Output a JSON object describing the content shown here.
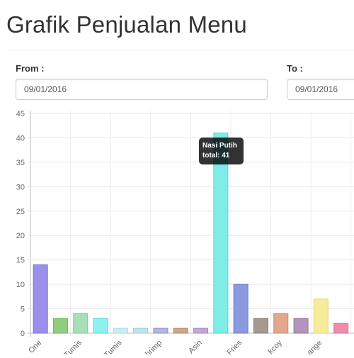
{
  "page": {
    "title": "Grafik Penjualan Menu"
  },
  "filters": {
    "from_label": "From :",
    "from_value": "09/01/2016",
    "to_label": "To :",
    "to_value": "09/01/2016"
  },
  "tooltip": {
    "title": "Nasi Putih",
    "body": "total: 41"
  },
  "chart_data": {
    "type": "bar",
    "title": "",
    "xlabel": "",
    "ylabel": "",
    "ylim": [
      0,
      45
    ],
    "yticks": [
      0,
      5,
      10,
      15,
      20,
      25,
      30,
      35,
      40,
      45
    ],
    "grid": true,
    "categories": [
      "One",
      "Tumis",
      "Tumis",
      "hrimp",
      "Asin",
      "",
      "Fries",
      "kcoy",
      "ange",
      "",
      "",
      ""
    ],
    "values": [
      14,
      3,
      4,
      3,
      1,
      1,
      1,
      1,
      1,
      41,
      10,
      3,
      4,
      3,
      7,
      2
    ],
    "labels": [
      "One",
      "",
      "Tumis",
      "",
      "Tumis",
      "",
      "hrimp",
      "",
      "Asin",
      "",
      "Fries",
      "",
      "kcoy",
      "",
      "ange",
      ""
    ],
    "colors": [
      "#9a90ec",
      "#8fcf7c",
      "#a6dfb8",
      "#8ff0f0",
      "#c8eef5",
      "#bfe4ee",
      "#b4b4de",
      "#c9a88e",
      "#c2a6dc",
      "#7fece8",
      "#8c99de",
      "#a49a90",
      "#e3a88c",
      "#b394bb",
      "#f6ec9c",
      "#f08ea9"
    ],
    "borders": [
      "#7b70d8",
      "#6cb85a",
      "#80c896",
      "#59d8d8",
      "#a8dce6",
      "#98cfdd",
      "#9090c8",
      "#b08a6e",
      "#a688c6",
      "#4fd8d3",
      "#6878c8",
      "#8a7e74",
      "#cf8a6c",
      "#9676a0",
      "#e6d873",
      "#db6b8c"
    ]
  }
}
